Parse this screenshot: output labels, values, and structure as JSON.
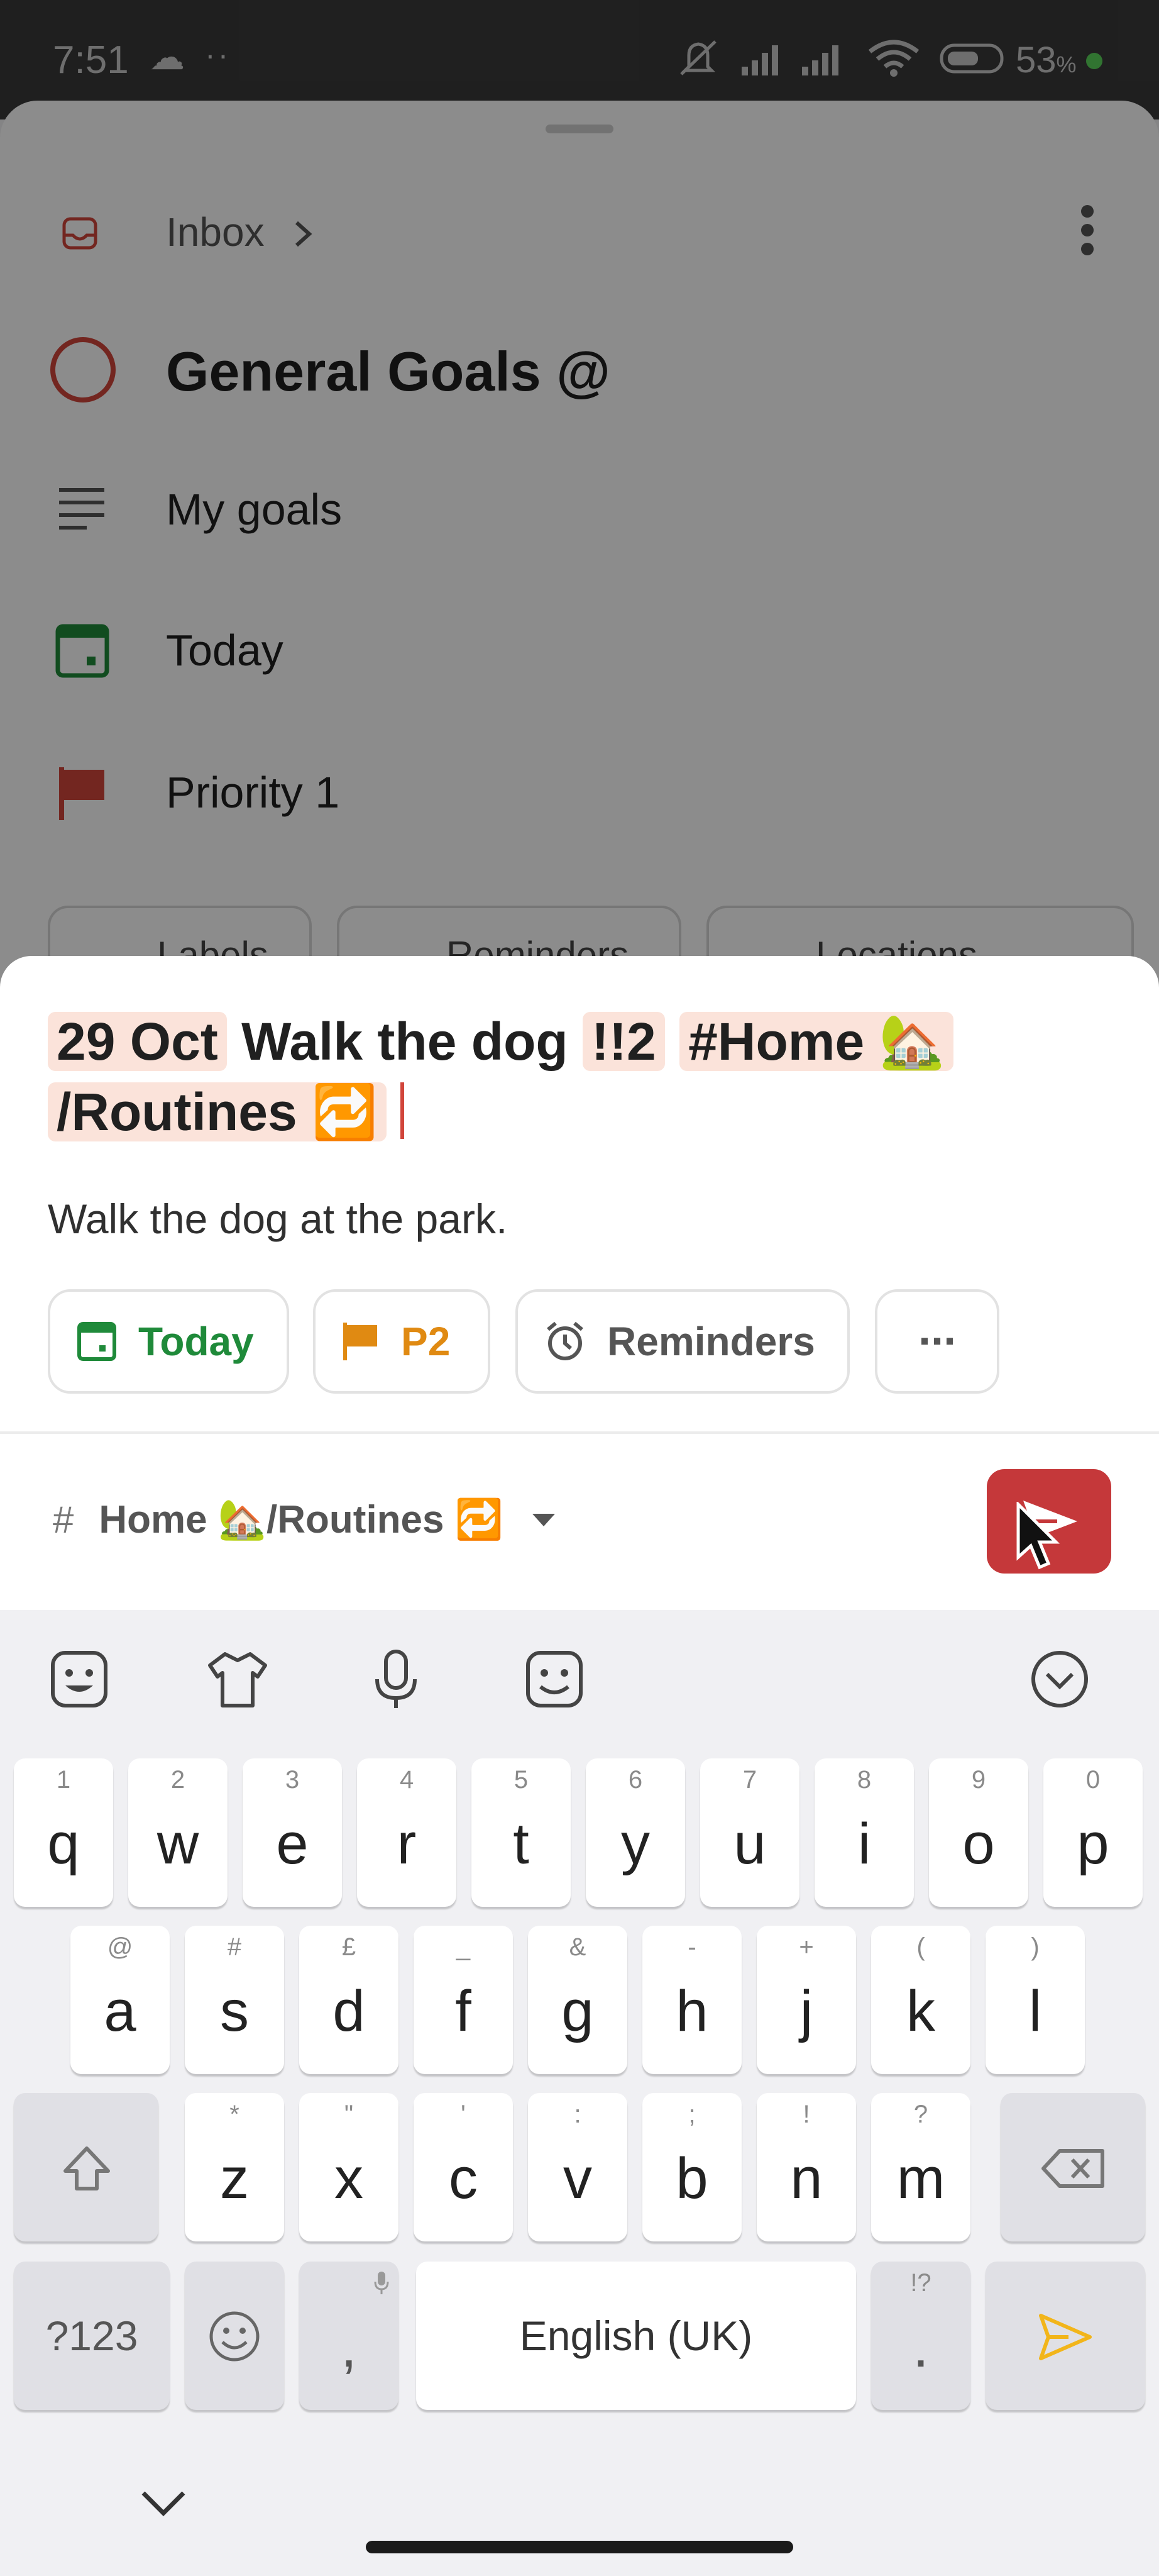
{
  "status_bar": {
    "time": "7:51",
    "dots": "··",
    "battery_percent": "53",
    "battery_unit": "%",
    "icons": [
      "cloud-icon",
      "mute-icon",
      "signal-icon",
      "signal-icon",
      "wifi-icon",
      "battery-icon"
    ]
  },
  "background_sheet": {
    "breadcrumb": "Inbox",
    "task_title": "General Goals @",
    "rows": [
      {
        "label": "My goals",
        "icon": "description-icon"
      },
      {
        "label": "Today",
        "icon": "calendar-icon"
      },
      {
        "label": "Priority 1",
        "icon": "flag-icon"
      }
    ],
    "chips": [
      "Labels",
      "Reminders",
      "Locations"
    ]
  },
  "quick_add": {
    "date_token": "29 Oct",
    "title_text": "Walk the dog",
    "priority_token": "!!2",
    "label_token": "#Home 🏡",
    "section_token": "/Routines 🔁",
    "description": "Walk the dog at the park.",
    "chips": {
      "date": "Today",
      "priority": "P2",
      "reminders": "Reminders",
      "more": "···"
    },
    "project": {
      "hash": "#",
      "label": "Home 🏡/Routines 🔁"
    },
    "colors": {
      "accent": "#c5383a",
      "today_green": "#1f8a3a",
      "priority_orange": "#e08a12",
      "token_bg": "#fbe3da"
    }
  },
  "keyboard": {
    "row1": [
      {
        "hint": "1",
        "key": "q"
      },
      {
        "hint": "2",
        "key": "w"
      },
      {
        "hint": "3",
        "key": "e"
      },
      {
        "hint": "4",
        "key": "r"
      },
      {
        "hint": "5",
        "key": "t"
      },
      {
        "hint": "6",
        "key": "y"
      },
      {
        "hint": "7",
        "key": "u"
      },
      {
        "hint": "8",
        "key": "i"
      },
      {
        "hint": "9",
        "key": "o"
      },
      {
        "hint": "0",
        "key": "p"
      }
    ],
    "row2": [
      {
        "hint": "@",
        "key": "a"
      },
      {
        "hint": "#",
        "key": "s"
      },
      {
        "hint": "£",
        "key": "d"
      },
      {
        "hint": "_",
        "key": "f"
      },
      {
        "hint": "&",
        "key": "g"
      },
      {
        "hint": "-",
        "key": "h"
      },
      {
        "hint": "+",
        "key": "j"
      },
      {
        "hint": "(",
        "key": "k"
      },
      {
        "hint": ")",
        "key": "l"
      }
    ],
    "row3": [
      {
        "hint": "*",
        "key": "z"
      },
      {
        "hint": "\"",
        "key": "x"
      },
      {
        "hint": "'",
        "key": "c"
      },
      {
        "hint": ":",
        "key": "v"
      },
      {
        "hint": ";",
        "key": "b"
      },
      {
        "hint": "!",
        "key": "n"
      },
      {
        "hint": "?",
        "key": "m"
      }
    ],
    "symbols_key": "?123",
    "comma_key": ",",
    "space_label": "English (UK)",
    "period_key": ".",
    "period_hint": "!?",
    "send_color": "#f2b51a"
  }
}
